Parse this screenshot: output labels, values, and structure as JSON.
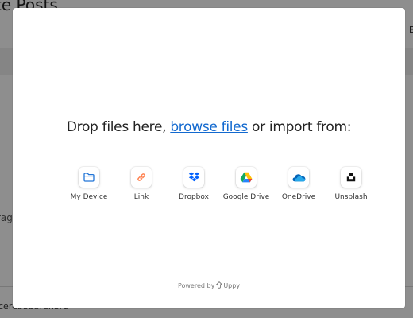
{
  "background": {
    "title_fragment": "te Posts",
    "right_fragment": "E",
    "left_fragment": "rag",
    "bottom_fragment": "cerebbbbrenbru"
  },
  "modal": {
    "drop_prefix": "Drop files here, ",
    "browse_label": "browse files",
    "drop_suffix": " or import from:",
    "providers": [
      {
        "label": "My Device",
        "icon": "folder-icon"
      },
      {
        "label": "Link",
        "icon": "link-icon"
      },
      {
        "label": "Dropbox",
        "icon": "dropbox-icon"
      },
      {
        "label": "Google Drive",
        "icon": "google-drive-icon"
      },
      {
        "label": "OneDrive",
        "icon": "onedrive-icon"
      },
      {
        "label": "Unsplash",
        "icon": "unsplash-icon"
      }
    ],
    "powered_prefix": "Powered by",
    "powered_brand": "Uppy"
  },
  "colors": {
    "link": "#1269cf",
    "overlay": "rgba(0,0,0,0.42)"
  }
}
